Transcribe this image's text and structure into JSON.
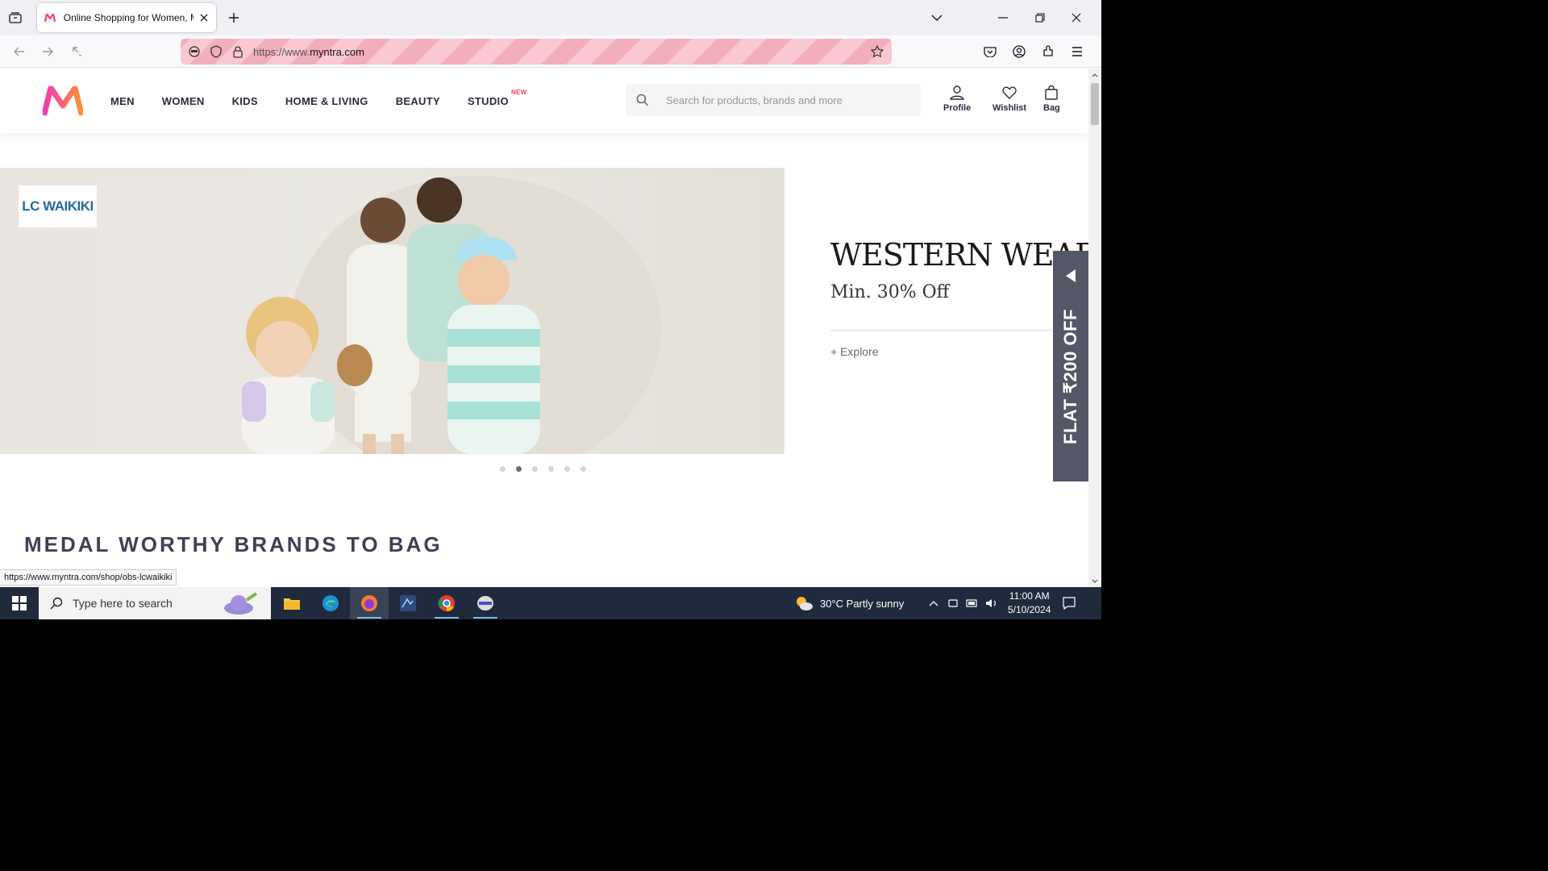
{
  "browser": {
    "tab_title": "Online Shopping for Women, M",
    "url_prefix": "https://www.",
    "url_host": "myntra.com",
    "status_url": "https://www.myntra.com/shop/obs-lcwaikiki"
  },
  "site": {
    "menu": [
      "MEN",
      "WOMEN",
      "KIDS",
      "HOME & LIVING",
      "BEAUTY",
      "STUDIO"
    ],
    "studio_badge": "NEW",
    "search_placeholder": "Search for products, brands and more",
    "actions": {
      "profile": "Profile",
      "wishlist": "Wishlist",
      "bag": "Bag"
    },
    "brand_color": "#ff3f6c"
  },
  "banner": {
    "brand": "LC WAIKIKI",
    "heading": "WESTERN WEAR",
    "subheading": "Min. 30% Off",
    "cta": "+ Explore",
    "slide_count": 6,
    "active_slide": 2
  },
  "section_title": "MEDAL WORTHY BRANDS TO BAG",
  "side_offer": "FLAT ₹200 OFF",
  "taskbar": {
    "search_placeholder": "Type here to search",
    "weather": "30°C  Partly sunny",
    "time": "11:00 AM",
    "date": "5/10/2024",
    "apps": [
      "file-explorer",
      "edge",
      "firefox",
      "app-4",
      "chrome",
      "app-6"
    ]
  }
}
